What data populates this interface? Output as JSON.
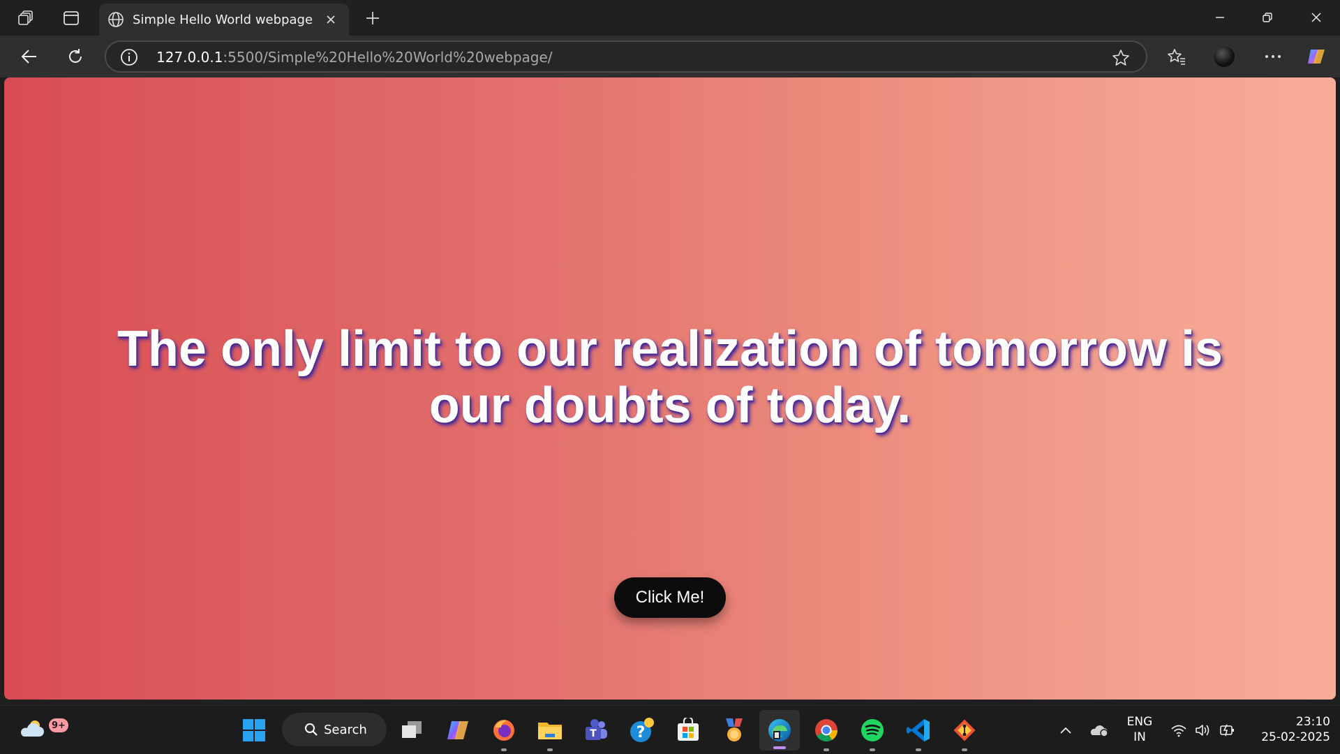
{
  "browser": {
    "tab": {
      "title": "Simple Hello World webpage"
    },
    "address_bar": {
      "host": "127.0.0.1",
      "path": ":5500/Simple%20Hello%20World%20webpage/"
    }
  },
  "page": {
    "quote": "The only limit to our realization of tomorrow is our doubts of today.",
    "button_label": "Click Me!",
    "colors": {
      "gradient_start": "#d84c52",
      "gradient_end": "#f8ad98",
      "text_shadow": "#4a2a9a",
      "button_bg": "#0c0c0c"
    }
  },
  "taskbar": {
    "weather_badge": "9+",
    "search_label": "Search",
    "apps": [
      "windows-start",
      "search",
      "task-view",
      "copilot",
      "firefox",
      "file-explorer",
      "teams",
      "get-help",
      "microsoft-store",
      "medal",
      "edge",
      "chrome",
      "spotify",
      "vscode",
      "git"
    ],
    "language": {
      "line1": "ENG",
      "line2": "IN"
    },
    "clock": {
      "time": "23:10",
      "date": "25-02-2025"
    }
  }
}
